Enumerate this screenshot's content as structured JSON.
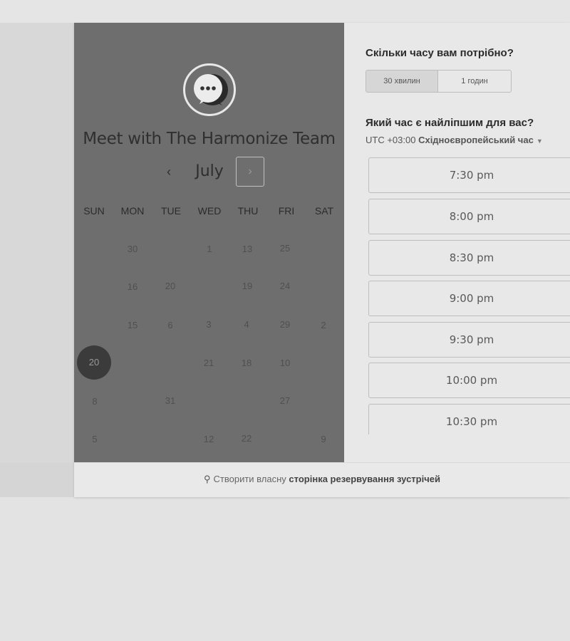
{
  "calendar": {
    "title": "Meet with The Harmonize Team",
    "month": "July",
    "prev_icon": "‹",
    "next_icon": "›",
    "weekdays": [
      "SUN",
      "MON",
      "TUE",
      "WED",
      "THU",
      "FRI",
      "SAT"
    ],
    "days": [
      "30",
      "1",
      "13",
      "25",
      "16",
      "20",
      "19",
      "24",
      "15",
      "6",
      "3",
      "4",
      "29",
      "2",
      "20",
      "21",
      "18",
      "10",
      "8",
      "31",
      "27",
      "5",
      "12",
      "22",
      "9"
    ],
    "selected_day": "20"
  },
  "duration": {
    "question": "Скільки часу вам потрібно?",
    "options": [
      "30 хвилин",
      "1 годин"
    ],
    "selected": "30 хвилин"
  },
  "time": {
    "question": "Який час є найліпшим для вас?",
    "timezone_offset": "UTC +03:00",
    "timezone_name": "Східноєвропейський час",
    "slots": [
      "7:30 pm",
      "8:00 pm",
      "8:30 pm",
      "9:00 pm",
      "9:30 pm",
      "10:00 pm",
      "10:30 pm"
    ]
  },
  "footer": {
    "prefix": "Створити власну",
    "link": "сторінка резервування зустрічей"
  }
}
